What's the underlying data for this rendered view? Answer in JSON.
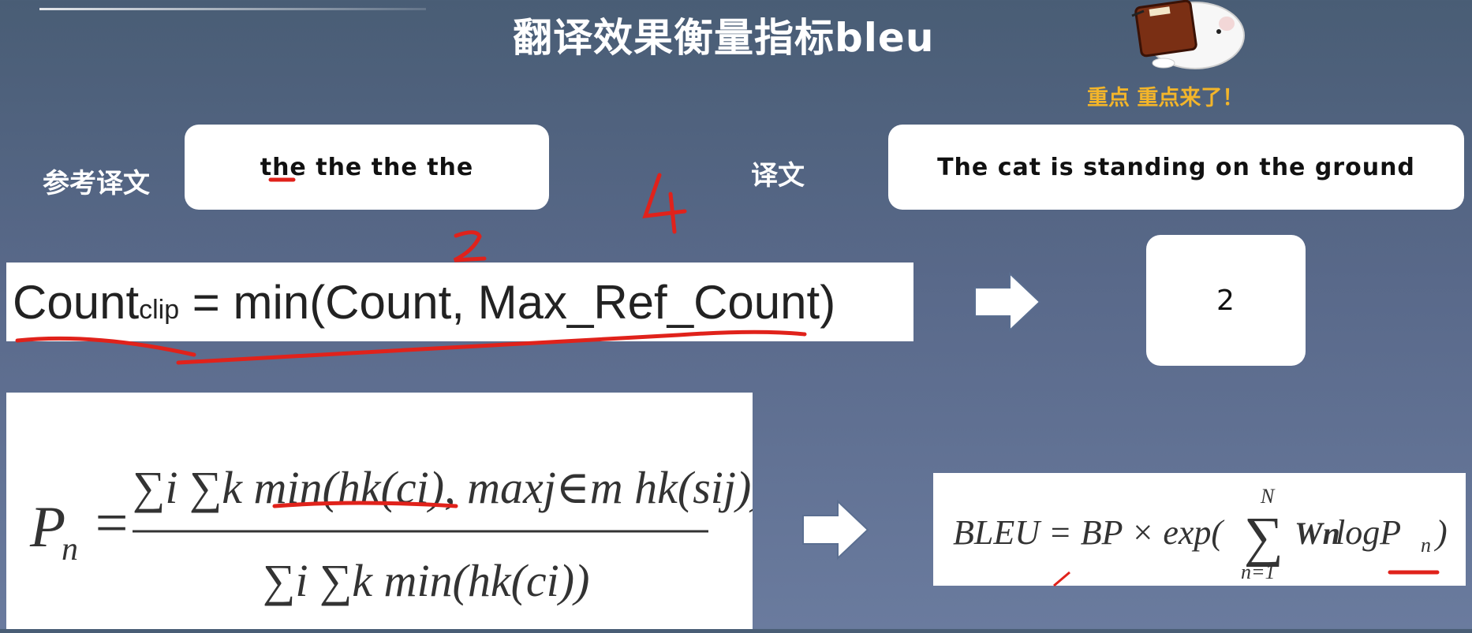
{
  "title": "翻译效果衡量指标bleu",
  "mascot": {
    "caption": "重点  重点来了！",
    "icon": "hamster-with-book-icon"
  },
  "reference": {
    "label": "参考译文",
    "text": "the the the the"
  },
  "candidate": {
    "label": "译文",
    "text": "The cat is standing on the ground"
  },
  "count_formula": {
    "main": "Count",
    "sub": "clip",
    "rest": " = min(Count, Max_Ref_Count)"
  },
  "result_value": "2",
  "annotations": {
    "two": "2",
    "four": "4"
  },
  "pn_formula": {
    "lhs": "P",
    "lhs_sub": "n",
    "numerator": "∑i ∑k min(hk(ci), maxj∈m hk(sij))",
    "denominator": "∑i ∑k min(hk(ci))"
  },
  "bleu_formula": {
    "left": "BLEU = BP × exp(",
    "sum_top": "N",
    "sum_bottom": "n=1",
    "weight": "Wn",
    "right": "logP",
    "right_sub": "n",
    "close": ")"
  },
  "colors": {
    "accent_red": "#e0221b",
    "accent_orange": "#f3b52a",
    "bg": "#56678a"
  }
}
